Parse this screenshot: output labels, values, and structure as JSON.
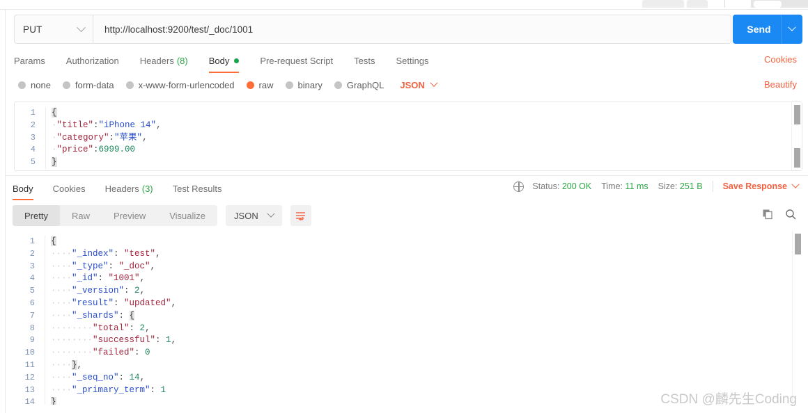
{
  "request": {
    "method": "PUT",
    "url": "http://localhost:9200/test/_doc/1001",
    "send_label": "Send",
    "tabs": [
      {
        "label": "Params",
        "count": "",
        "active": false,
        "dot": false
      },
      {
        "label": "Authorization",
        "count": "",
        "active": false,
        "dot": false
      },
      {
        "label": "Headers",
        "count": "(8)",
        "active": false,
        "dot": false
      },
      {
        "label": "Body",
        "count": "",
        "active": true,
        "dot": true
      },
      {
        "label": "Pre-request Script",
        "count": "",
        "active": false,
        "dot": false
      },
      {
        "label": "Tests",
        "count": "",
        "active": false,
        "dot": false
      },
      {
        "label": "Settings",
        "count": "",
        "active": false,
        "dot": false
      }
    ],
    "cookies_link": "Cookies",
    "beautify_link": "Beautify",
    "body_types": [
      {
        "label": "none",
        "selected": false
      },
      {
        "label": "form-data",
        "selected": false
      },
      {
        "label": "x-www-form-urlencoded",
        "selected": false
      },
      {
        "label": "raw",
        "selected": true
      },
      {
        "label": "binary",
        "selected": false
      },
      {
        "label": "GraphQL",
        "selected": false
      }
    ],
    "format": "JSON",
    "body_lines": [
      {
        "n": "1",
        "tokens": [
          {
            "t": "{",
            "c": "brace"
          }
        ]
      },
      {
        "n": "2",
        "tokens": [
          {
            "t": "·",
            "c": "ind"
          },
          {
            "t": "\"title\"",
            "c": "k-req"
          },
          {
            "t": ":",
            "c": "p-req"
          },
          {
            "t": "\"iPhone 14\"",
            "c": "s-req"
          },
          {
            "t": ",",
            "c": "p-req"
          }
        ]
      },
      {
        "n": "3",
        "tokens": [
          {
            "t": "·",
            "c": "ind"
          },
          {
            "t": "\"category\"",
            "c": "k-req"
          },
          {
            "t": ":",
            "c": "p-req"
          },
          {
            "t": "\"苹果\"",
            "c": "s-req"
          },
          {
            "t": ",",
            "c": "p-req"
          }
        ]
      },
      {
        "n": "4",
        "tokens": [
          {
            "t": "·",
            "c": "ind"
          },
          {
            "t": "\"price\"",
            "c": "k-req"
          },
          {
            "t": ":",
            "c": "p-req"
          },
          {
            "t": "6999.00",
            "c": "n-req"
          }
        ]
      },
      {
        "n": "5",
        "tokens": [
          {
            "t": "}",
            "c": "brace"
          }
        ]
      }
    ]
  },
  "response": {
    "tabs": [
      {
        "label": "Body",
        "count": "",
        "active": true
      },
      {
        "label": "Cookies",
        "count": "",
        "active": false
      },
      {
        "label": "Headers",
        "count": "(3)",
        "active": false
      },
      {
        "label": "Test Results",
        "count": "",
        "active": false
      }
    ],
    "status_label": "Status:",
    "status_value": "200 OK",
    "time_label": "Time:",
    "time_value": "11 ms",
    "size_label": "Size:",
    "size_value": "251 B",
    "save_response": "Save Response",
    "view_modes": [
      {
        "label": "Pretty",
        "active": true
      },
      {
        "label": "Raw",
        "active": false
      },
      {
        "label": "Preview",
        "active": false
      },
      {
        "label": "Visualize",
        "active": false
      }
    ],
    "format": "JSON",
    "body_lines": [
      {
        "n": "1",
        "tokens": [
          {
            "t": "{",
            "c": "brace"
          }
        ]
      },
      {
        "n": "2",
        "tokens": [
          {
            "t": "····",
            "c": "ind"
          },
          {
            "t": "\"_index\"",
            "c": "k-res"
          },
          {
            "t": ": ",
            "c": "p-res"
          },
          {
            "t": "\"test\"",
            "c": "s-res"
          },
          {
            "t": ",",
            "c": "p-res"
          }
        ]
      },
      {
        "n": "3",
        "tokens": [
          {
            "t": "····",
            "c": "ind"
          },
          {
            "t": "\"_type\"",
            "c": "k-res"
          },
          {
            "t": ": ",
            "c": "p-res"
          },
          {
            "t": "\"_doc\"",
            "c": "s-res"
          },
          {
            "t": ",",
            "c": "p-res"
          }
        ]
      },
      {
        "n": "4",
        "tokens": [
          {
            "t": "····",
            "c": "ind"
          },
          {
            "t": "\"_id\"",
            "c": "k-res"
          },
          {
            "t": ": ",
            "c": "p-res"
          },
          {
            "t": "\"1001\"",
            "c": "s-res"
          },
          {
            "t": ",",
            "c": "p-res"
          }
        ]
      },
      {
        "n": "5",
        "tokens": [
          {
            "t": "····",
            "c": "ind"
          },
          {
            "t": "\"_version\"",
            "c": "k-res"
          },
          {
            "t": ": ",
            "c": "p-res"
          },
          {
            "t": "2",
            "c": "n-res"
          },
          {
            "t": ",",
            "c": "p-res"
          }
        ]
      },
      {
        "n": "6",
        "tokens": [
          {
            "t": "····",
            "c": "ind"
          },
          {
            "t": "\"result\"",
            "c": "k-res"
          },
          {
            "t": ": ",
            "c": "p-res"
          },
          {
            "t": "\"updated\"",
            "c": "s-res"
          },
          {
            "t": ",",
            "c": "p-res"
          }
        ]
      },
      {
        "n": "7",
        "tokens": [
          {
            "t": "····",
            "c": "ind"
          },
          {
            "t": "\"_shards\"",
            "c": "k-res"
          },
          {
            "t": ": ",
            "c": "p-res"
          },
          {
            "t": "{",
            "c": "brace"
          }
        ]
      },
      {
        "n": "8",
        "tokens": [
          {
            "t": "········",
            "c": "ind"
          },
          {
            "t": "\"total\"",
            "c": "s-res"
          },
          {
            "t": ": ",
            "c": "p-res"
          },
          {
            "t": "2",
            "c": "n-res"
          },
          {
            "t": ",",
            "c": "p-res"
          }
        ]
      },
      {
        "n": "9",
        "tokens": [
          {
            "t": "········",
            "c": "ind"
          },
          {
            "t": "\"successful\"",
            "c": "s-res"
          },
          {
            "t": ": ",
            "c": "p-res"
          },
          {
            "t": "1",
            "c": "n-res"
          },
          {
            "t": ",",
            "c": "p-res"
          }
        ]
      },
      {
        "n": "10",
        "tokens": [
          {
            "t": "········",
            "c": "ind"
          },
          {
            "t": "\"failed\"",
            "c": "s-res"
          },
          {
            "t": ": ",
            "c": "p-res"
          },
          {
            "t": "0",
            "c": "n-res"
          }
        ]
      },
      {
        "n": "11",
        "tokens": [
          {
            "t": "····",
            "c": "ind"
          },
          {
            "t": "}",
            "c": "brace"
          },
          {
            "t": ",",
            "c": "p-res"
          }
        ]
      },
      {
        "n": "12",
        "tokens": [
          {
            "t": "····",
            "c": "ind"
          },
          {
            "t": "\"_seq_no\"",
            "c": "k-res"
          },
          {
            "t": ": ",
            "c": "p-res"
          },
          {
            "t": "14",
            "c": "n-res"
          },
          {
            "t": ",",
            "c": "p-res"
          }
        ]
      },
      {
        "n": "13",
        "tokens": [
          {
            "t": "····",
            "c": "ind"
          },
          {
            "t": "\"_primary_term\"",
            "c": "k-res"
          },
          {
            "t": ": ",
            "c": "p-res"
          },
          {
            "t": "1",
            "c": "n-res"
          }
        ]
      },
      {
        "n": "14",
        "tokens": [
          {
            "t": "}",
            "c": "brace"
          }
        ]
      }
    ]
  },
  "watermark": "CSDN @麟先生Coding"
}
